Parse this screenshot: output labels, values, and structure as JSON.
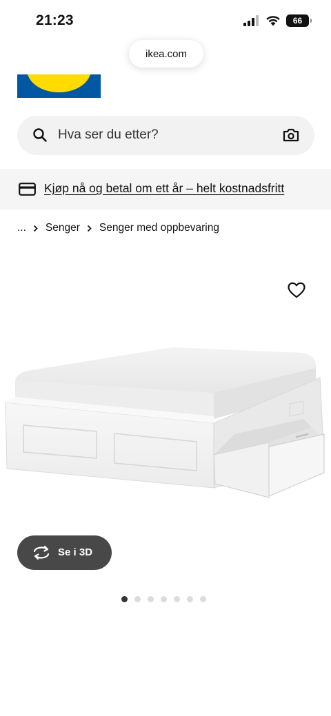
{
  "status_bar": {
    "time": "21:23",
    "battery": "66"
  },
  "browser": {
    "url": "ikea.com"
  },
  "brand": {
    "logo_colors": {
      "blue": "#0058a3",
      "yellow": "#ffdb00"
    }
  },
  "search": {
    "placeholder": "Hva ser du etter?",
    "icons": [
      "search-icon",
      "camera-icon"
    ]
  },
  "promo": {
    "text": "Kjøp nå og betal om ett år – helt kostnadsfritt",
    "icon": "credit-card-icon"
  },
  "breadcrumb": {
    "items": [
      "...",
      "Senger",
      "Senger med oppbevaring"
    ]
  },
  "product": {
    "wishlist_icon": "heart-icon",
    "view_3d_label": "Se i 3D",
    "carousel": {
      "total": 7,
      "active": 1
    }
  },
  "colors": {
    "button_dark": "#484848",
    "banner_bg": "#f5f5f5",
    "search_bg": "#f2f2f2"
  }
}
